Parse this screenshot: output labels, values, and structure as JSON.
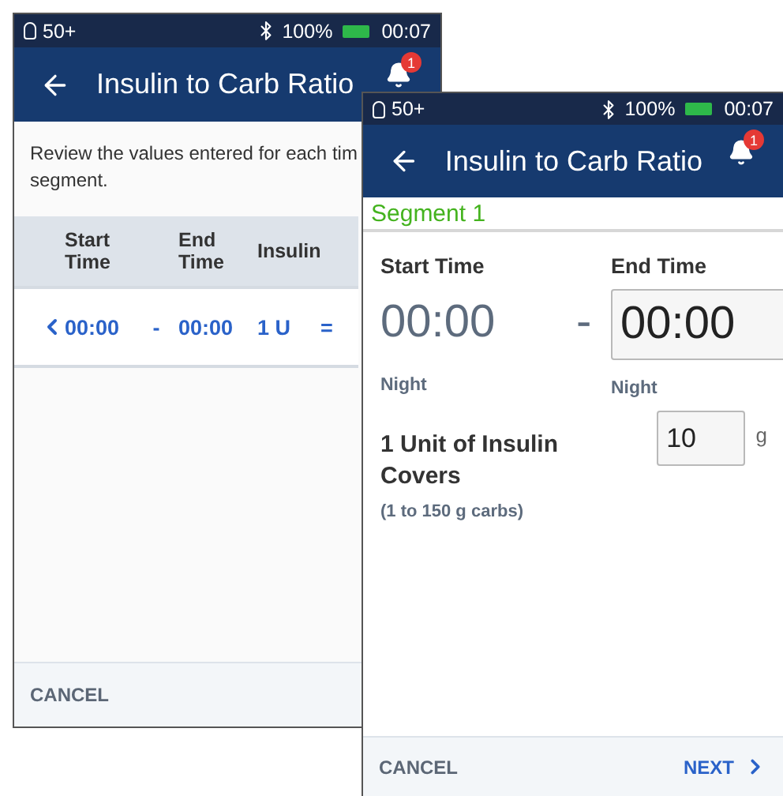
{
  "review_screen": {
    "status": {
      "pod": "50+",
      "battery": "100%",
      "time": "00:07"
    },
    "header": {
      "title": "Insulin to Carb Ratio",
      "badge": "1"
    },
    "intro": [
      "Review the values entered for each tim",
      "segment."
    ],
    "columns": [
      {
        "label": "Start Time"
      },
      {
        "label": "End Time"
      },
      {
        "label": "Insulin"
      }
    ],
    "rows": [
      {
        "start": "00:00",
        "dash": "-",
        "end": "00:00",
        "insulin": "1 U",
        "equals": "="
      }
    ],
    "footer": {
      "cancel": "CANCEL"
    }
  },
  "segment_screen": {
    "status": {
      "pod": "50+",
      "battery": "100%",
      "time": "00:07"
    },
    "header": {
      "title": "Insulin to Carb Ratio",
      "badge": "1"
    },
    "segment": "Segment 1",
    "start": {
      "label": "Start Time",
      "value": "00:00",
      "period": "Night"
    },
    "dash": "-",
    "end": {
      "label": "End Time",
      "value": "00:00",
      "period": "Night"
    },
    "ratio": {
      "label": "1 Unit of Insulin Covers",
      "value": "10",
      "unit": "g",
      "hint": "(1 to 150 g carbs)"
    },
    "footer": {
      "cancel": "CANCEL",
      "next": "NEXT"
    }
  }
}
